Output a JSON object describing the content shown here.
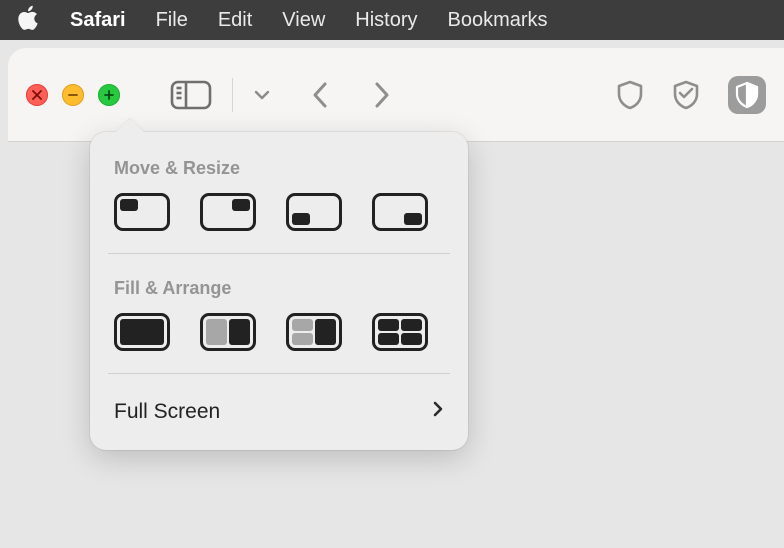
{
  "menubar": {
    "items": [
      "Safari",
      "File",
      "Edit",
      "View",
      "History",
      "Bookmarks"
    ]
  },
  "popover": {
    "section_move": "Move & Resize",
    "section_fill": "Fill & Arrange",
    "full_screen": "Full Screen"
  }
}
